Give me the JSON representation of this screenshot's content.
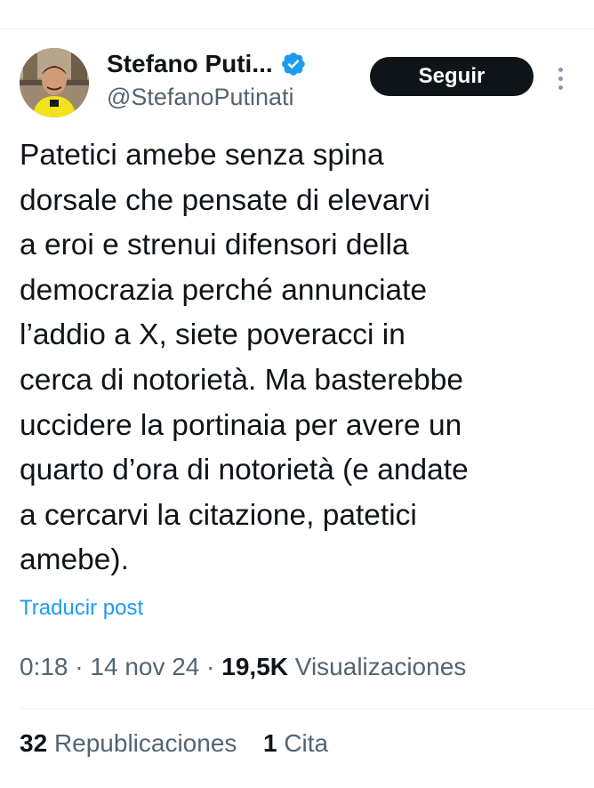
{
  "author": {
    "display_name": "Stefano Puti...",
    "handle": "@StefanoPutinati",
    "verified": true,
    "avatar_icon": "user-avatar-photo"
  },
  "actions": {
    "follow_label": "Seguir",
    "more_icon": "more-vertical-icon"
  },
  "post": {
    "text": "Patetici amebe senza spina\ndorsale che pensate di elevarvi\na eroi e strenui difensori della\ndemocrazia perché annunciate\nl’addio a X, siete poveracci in\ncerca di notorietà. Ma basterebbe\nuccidere la portinaia per avere un\nquarto d’ora di notorietà (e andate\na cercarvi la citazione, patetici\namebe).",
    "translate_label": "Traducir post"
  },
  "meta": {
    "time": "0:18",
    "separator": "·",
    "date": "14 nov 24",
    "views_count": "19,5K",
    "views_label": "Visualizaciones"
  },
  "stats": {
    "reposts_count": "32",
    "reposts_label": "Republicaciones",
    "quotes_count": "1",
    "quotes_label": "Cita"
  },
  "colors": {
    "text_primary": "#0f1419",
    "text_secondary": "#536471",
    "link_blue": "#1d9bf0",
    "verified_blue": "#1d9bf0",
    "divider": "#eff3f4"
  }
}
